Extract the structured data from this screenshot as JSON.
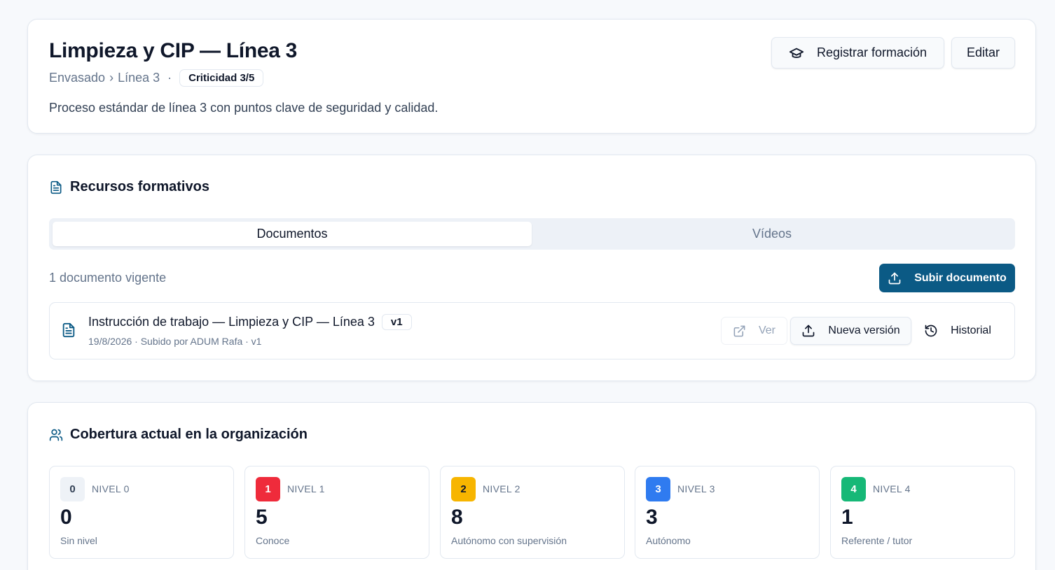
{
  "header": {
    "title": "Limpieza y CIP — Línea 3",
    "breadcrumb_area": "Envasado",
    "breadcrumb_sep": "›",
    "breadcrumb_line": "Línea 3",
    "dot": "·",
    "criticality": "Criticidad 3/5",
    "description": "Proceso estándar de línea 3 con puntos clave de seguridad y calidad.",
    "register_label": "Registrar formación",
    "edit_label": "Editar"
  },
  "resources": {
    "title": "Recursos formativos",
    "tabs": [
      {
        "label": "Documentos",
        "active": true
      },
      {
        "label": "Vídeos",
        "active": false
      }
    ],
    "count_label": "1 documento vigente",
    "upload_label": "Subir documento",
    "documents": [
      {
        "title": "Instrucción de trabajo — Limpieza y CIP — Línea 3",
        "version": "v1",
        "subtitle": "19/8/2026 · Subido por ADUM Rafa · v1",
        "view_label": "Ver",
        "new_version_label": "Nueva versión",
        "history_label": "Historial"
      }
    ]
  },
  "coverage": {
    "title": "Cobertura actual en la organización",
    "levels": [
      {
        "num": "0",
        "label": "NIVEL 0",
        "count": "0",
        "desc": "Sin nivel",
        "color": "#eef2f7",
        "text_color": "#334155"
      },
      {
        "num": "1",
        "label": "NIVEL 1",
        "count": "5",
        "desc": "Conoce",
        "color": "#ef2b3b",
        "text_color": "#ffffff"
      },
      {
        "num": "2",
        "label": "NIVEL 2",
        "count": "8",
        "desc": "Autónomo con supervisión",
        "color": "#f7b500",
        "text_color": "#0f172a"
      },
      {
        "num": "3",
        "label": "NIVEL 3",
        "count": "3",
        "desc": "Autónomo",
        "color": "#2f7bf0",
        "text_color": "#ffffff"
      },
      {
        "num": "4",
        "label": "NIVEL 4",
        "count": "1",
        "desc": "Referente / tutor",
        "color": "#16b877",
        "text_color": "#ffffff"
      }
    ]
  },
  "colors": {
    "primary": "#0b5a85",
    "icon_accent": "#0b5a85"
  }
}
